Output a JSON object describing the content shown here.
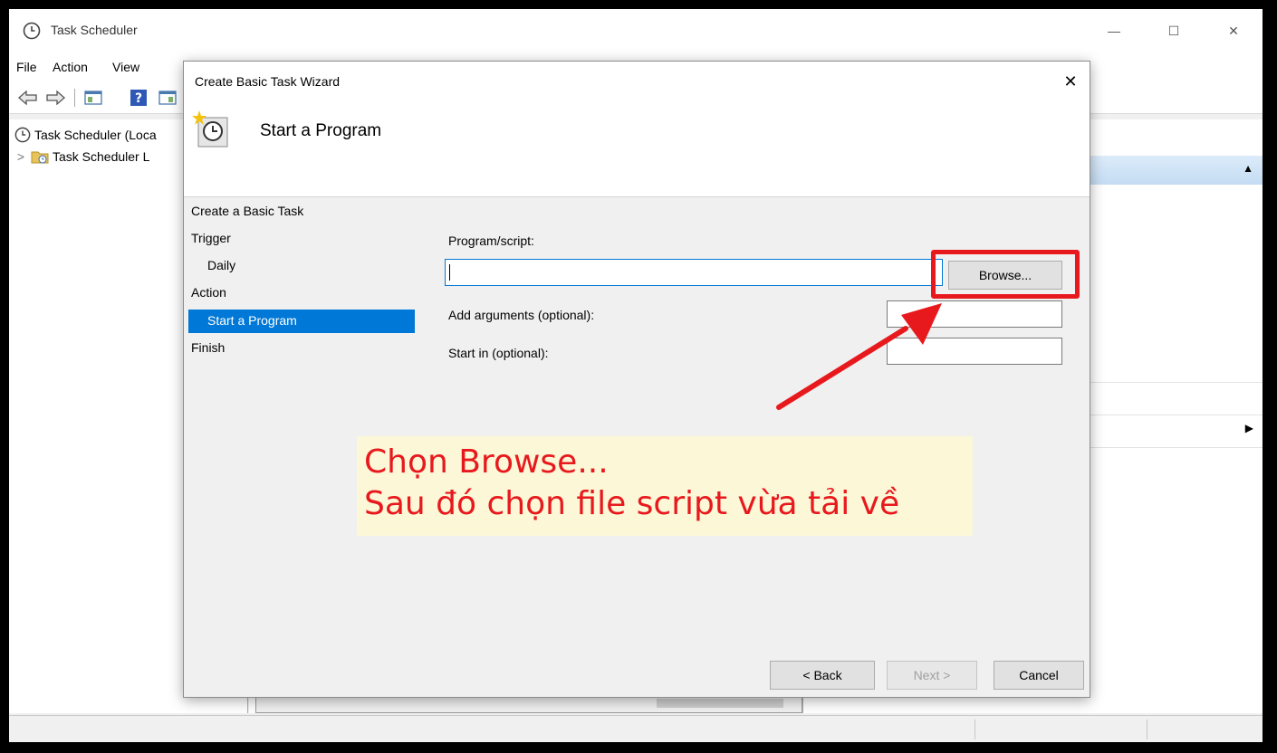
{
  "app": {
    "title": "Task Scheduler",
    "controls": {
      "minimize": "—",
      "maximize": "☐",
      "close": "✕"
    }
  },
  "menu": [
    "File",
    "Action",
    "View"
  ],
  "toolbar_icons": [
    "back-arrow-icon",
    "forward-arrow-icon",
    "show-hide-console-tree-icon",
    "help-icon",
    "show-hide-action-pane-icon"
  ],
  "tree": [
    {
      "label": "Task Scheduler (Loca",
      "icon": "clock-icon"
    },
    {
      "label": "Task Scheduler L",
      "icon": "folder-clock-icon",
      "expander": ">"
    }
  ],
  "right_pane": {
    "scroll_up": "▲",
    "expand_arrow": "▶"
  },
  "wizard": {
    "title": "Create Basic Task Wizard",
    "close": "✕",
    "heading": "Start a Program",
    "nav": [
      {
        "label": "Create a Basic Task",
        "level": 0
      },
      {
        "label": "Trigger",
        "level": 0
      },
      {
        "label": "Daily",
        "level": 1
      },
      {
        "label": "Action",
        "level": 0
      },
      {
        "label": "Start a Program",
        "level": 1,
        "selected": true
      },
      {
        "label": "Finish",
        "level": 0
      }
    ],
    "form": {
      "program_label": "Program/script:",
      "program_value": "",
      "browse_label": "Browse...",
      "args_label": "Add arguments (optional):",
      "args_value": "",
      "startin_label": "Start in (optional):",
      "startin_value": ""
    },
    "buttons": {
      "back": "< Back",
      "next": "Next >",
      "cancel": "Cancel"
    }
  },
  "annotation": {
    "line1": "Chọn Browse...",
    "line2": "Sau đó chọn file script vừa tải về",
    "color": "#e8191d",
    "callout_bg": "#fbf7d7"
  }
}
